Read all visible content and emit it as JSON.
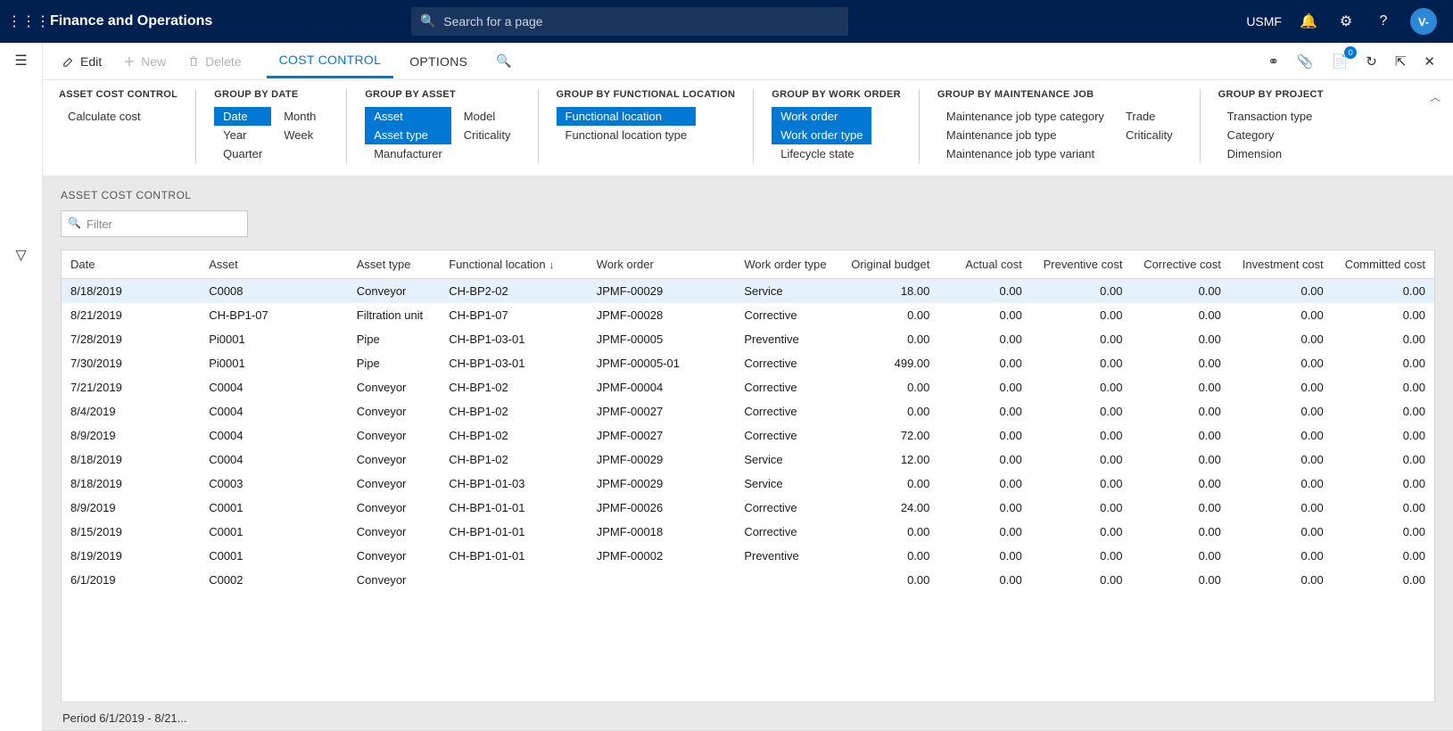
{
  "header": {
    "app_title": "Finance and Operations",
    "search_placeholder": "Search for a page",
    "company": "USMF",
    "avatar_letter": "V-"
  },
  "cmdbar": {
    "edit": "Edit",
    "new": "New",
    "delete": "Delete",
    "tab_cost_control": "COST CONTROL",
    "tab_options": "OPTIONS",
    "attach_badge": "0"
  },
  "ribbon": {
    "g_asset_cost": {
      "title": "ASSET COST CONTROL",
      "calculate": "Calculate cost"
    },
    "g_date": {
      "title": "GROUP BY DATE",
      "date": "Date",
      "year": "Year",
      "quarter": "Quarter",
      "month": "Month",
      "week": "Week"
    },
    "g_asset": {
      "title": "GROUP BY ASSET",
      "asset": "Asset",
      "asset_type": "Asset type",
      "manufacturer": "Manufacturer",
      "model": "Model",
      "criticality": "Criticality"
    },
    "g_fl": {
      "title": "GROUP BY FUNCTIONAL LOCATION",
      "fl": "Functional location",
      "fl_type": "Functional location type"
    },
    "g_wo": {
      "title": "GROUP BY WORK ORDER",
      "wo": "Work order",
      "wo_type": "Work order type",
      "lifecycle": "Lifecycle state"
    },
    "g_mj": {
      "title": "GROUP BY MAINTENANCE JOB",
      "mjtc": "Maintenance job type category",
      "mjt": "Maintenance job type",
      "mjtv": "Maintenance job type variant",
      "trade": "Trade",
      "criticality": "Criticality"
    },
    "g_proj": {
      "title": "GROUP BY PROJECT",
      "tt": "Transaction type",
      "cat": "Category",
      "dim": "Dimension"
    }
  },
  "grid": {
    "heading": "ASSET COST CONTROL",
    "filter_placeholder": "Filter",
    "columns": {
      "date": "Date",
      "asset": "Asset",
      "asset_type": "Asset type",
      "fl": "Functional location",
      "wo": "Work order",
      "wo_type": "Work order type",
      "orig_budget": "Original budget",
      "actual": "Actual cost",
      "preventive": "Preventive cost",
      "corrective": "Corrective cost",
      "investment": "Investment cost",
      "committed": "Committed cost"
    },
    "rows": [
      {
        "date": "8/18/2019",
        "asset": "C0008",
        "asset_type": "Conveyor",
        "fl": "CH-BP2-02",
        "wo": "JPMF-00029",
        "wo_type": "Service",
        "orig_budget": "18.00",
        "actual": "0.00",
        "preventive": "0.00",
        "corrective": "0.00",
        "investment": "0.00",
        "committed": "0.00"
      },
      {
        "date": "8/21/2019",
        "asset": "CH-BP1-07",
        "asset_type": "Filtration unit",
        "fl": "CH-BP1-07",
        "wo": "JPMF-00028",
        "wo_type": "Corrective",
        "orig_budget": "0.00",
        "actual": "0.00",
        "preventive": "0.00",
        "corrective": "0.00",
        "investment": "0.00",
        "committed": "0.00"
      },
      {
        "date": "7/28/2019",
        "asset": "Pi0001",
        "asset_type": "Pipe",
        "fl": "CH-BP1-03-01",
        "wo": "JPMF-00005",
        "wo_type": "Preventive",
        "orig_budget": "0.00",
        "actual": "0.00",
        "preventive": "0.00",
        "corrective": "0.00",
        "investment": "0.00",
        "committed": "0.00"
      },
      {
        "date": "7/30/2019",
        "asset": "Pi0001",
        "asset_type": "Pipe",
        "fl": "CH-BP1-03-01",
        "wo": "JPMF-00005-01",
        "wo_type": "Corrective",
        "orig_budget": "499.00",
        "actual": "0.00",
        "preventive": "0.00",
        "corrective": "0.00",
        "investment": "0.00",
        "committed": "0.00"
      },
      {
        "date": "7/21/2019",
        "asset": "C0004",
        "asset_type": "Conveyor",
        "fl": "CH-BP1-02",
        "wo": "JPMF-00004",
        "wo_type": "Corrective",
        "orig_budget": "0.00",
        "actual": "0.00",
        "preventive": "0.00",
        "corrective": "0.00",
        "investment": "0.00",
        "committed": "0.00"
      },
      {
        "date": "8/4/2019",
        "asset": "C0004",
        "asset_type": "Conveyor",
        "fl": "CH-BP1-02",
        "wo": "JPMF-00027",
        "wo_type": "Corrective",
        "orig_budget": "0.00",
        "actual": "0.00",
        "preventive": "0.00",
        "corrective": "0.00",
        "investment": "0.00",
        "committed": "0.00"
      },
      {
        "date": "8/9/2019",
        "asset": "C0004",
        "asset_type": "Conveyor",
        "fl": "CH-BP1-02",
        "wo": "JPMF-00027",
        "wo_type": "Corrective",
        "orig_budget": "72.00",
        "actual": "0.00",
        "preventive": "0.00",
        "corrective": "0.00",
        "investment": "0.00",
        "committed": "0.00"
      },
      {
        "date": "8/18/2019",
        "asset": "C0004",
        "asset_type": "Conveyor",
        "fl": "CH-BP1-02",
        "wo": "JPMF-00029",
        "wo_type": "Service",
        "orig_budget": "12.00",
        "actual": "0.00",
        "preventive": "0.00",
        "corrective": "0.00",
        "investment": "0.00",
        "committed": "0.00"
      },
      {
        "date": "8/18/2019",
        "asset": "C0003",
        "asset_type": "Conveyor",
        "fl": "CH-BP1-01-03",
        "wo": "JPMF-00029",
        "wo_type": "Service",
        "orig_budget": "0.00",
        "actual": "0.00",
        "preventive": "0.00",
        "corrective": "0.00",
        "investment": "0.00",
        "committed": "0.00"
      },
      {
        "date": "8/9/2019",
        "asset": "C0001",
        "asset_type": "Conveyor",
        "fl": "CH-BP1-01-01",
        "wo": "JPMF-00026",
        "wo_type": "Corrective",
        "orig_budget": "24.00",
        "actual": "0.00",
        "preventive": "0.00",
        "corrective": "0.00",
        "investment": "0.00",
        "committed": "0.00"
      },
      {
        "date": "8/15/2019",
        "asset": "C0001",
        "asset_type": "Conveyor",
        "fl": "CH-BP1-01-01",
        "wo": "JPMF-00018",
        "wo_type": "Corrective",
        "orig_budget": "0.00",
        "actual": "0.00",
        "preventive": "0.00",
        "corrective": "0.00",
        "investment": "0.00",
        "committed": "0.00"
      },
      {
        "date": "8/19/2019",
        "asset": "C0001",
        "asset_type": "Conveyor",
        "fl": "CH-BP1-01-01",
        "wo": "JPMF-00002",
        "wo_type": "Preventive",
        "orig_budget": "0.00",
        "actual": "0.00",
        "preventive": "0.00",
        "corrective": "0.00",
        "investment": "0.00",
        "committed": "0.00"
      },
      {
        "date": "6/1/2019",
        "asset": "C0002",
        "asset_type": "Conveyor",
        "fl": "",
        "wo": "",
        "wo_type": "",
        "orig_budget": "0.00",
        "actual": "0.00",
        "preventive": "0.00",
        "corrective": "0.00",
        "investment": "0.00",
        "committed": "0.00"
      }
    ]
  },
  "footer": {
    "period": "Period 6/1/2019 - 8/21..."
  }
}
